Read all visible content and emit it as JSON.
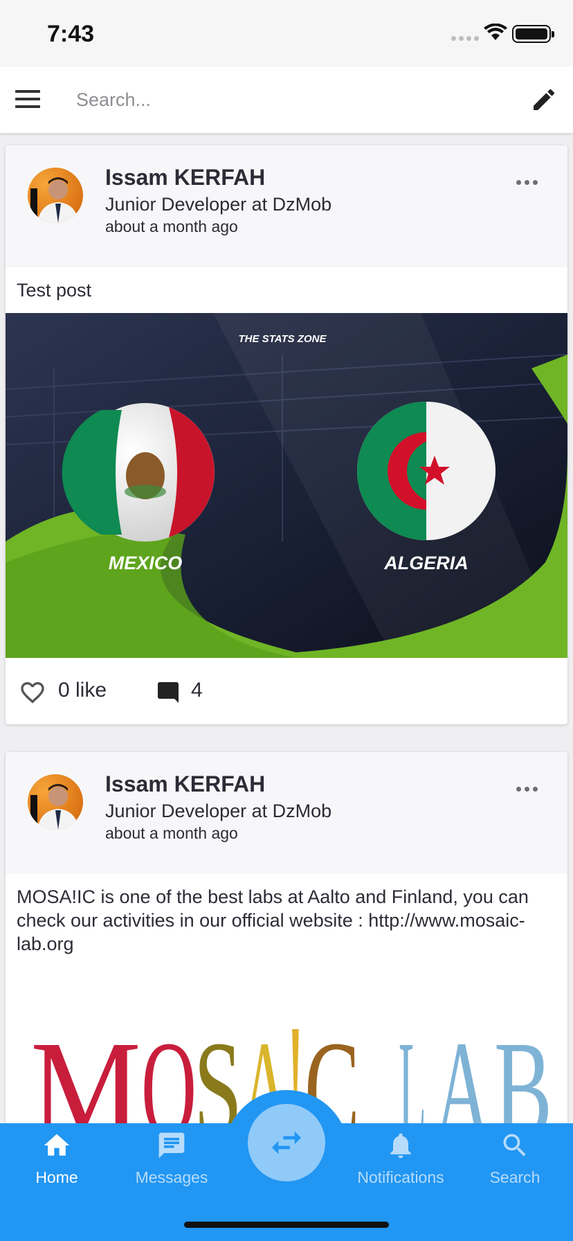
{
  "status_bar": {
    "time": "7:43"
  },
  "search": {
    "placeholder": "Search..."
  },
  "posts": [
    {
      "author": "Issam KERFAH",
      "role": "Junior Developer at DzMob",
      "time_ago": "about a month ago",
      "text": "Test post",
      "image": {
        "brand": "THE STATS ZONE",
        "team_left": "MEXICO",
        "team_right": "ALGERIA"
      },
      "likes_label": "0 like",
      "comments_count": "4"
    },
    {
      "author": "Issam KERFAH",
      "role": "Junior Developer at DzMob",
      "time_ago": "about a month ago",
      "text": "MOSA!IC is one of the best labs at Aalto and Finland, you can check our activities in our official website : http://www.mosaic-lab.org",
      "image": {
        "logo_text": "MOSAIC LAB"
      }
    }
  ],
  "bottom_nav": {
    "items": [
      {
        "label": "Home",
        "icon": "home-icon",
        "active": true
      },
      {
        "label": "Messages",
        "icon": "message-icon",
        "active": false
      },
      {
        "label": "Notifications",
        "icon": "bell-icon",
        "active": false
      },
      {
        "label": "Search",
        "icon": "search-icon",
        "active": false
      }
    ],
    "center_icon": "swap-icon"
  },
  "colors": {
    "primary": "#2196f3",
    "fab": "#90caf9",
    "inactive_label": "#b7dcfb"
  }
}
